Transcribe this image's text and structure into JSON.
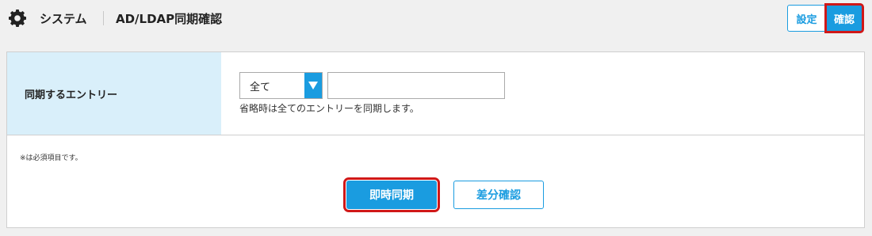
{
  "header": {
    "icon": "gear-icon",
    "breadcrumb_root": "システム",
    "page_title": "AD/LDAP同期確認",
    "tabs": [
      {
        "label": "設定",
        "active": false
      },
      {
        "label": "確認",
        "active": true
      }
    ]
  },
  "form": {
    "row_label": "同期するエントリー",
    "select": {
      "value": "全て",
      "icon": "chevron-down-icon"
    },
    "input": {
      "value": "",
      "placeholder": ""
    },
    "hint": "省略時は全てのエントリーを同期します。"
  },
  "note": "※は必須項目です。",
  "buttons": {
    "sync_now": "即時同期",
    "diff_check": "差分確認"
  },
  "colors": {
    "accent": "#1a9ce0",
    "label_bg": "#d9effa",
    "highlight": "#d01818",
    "page_bg": "#f0f0f0"
  }
}
